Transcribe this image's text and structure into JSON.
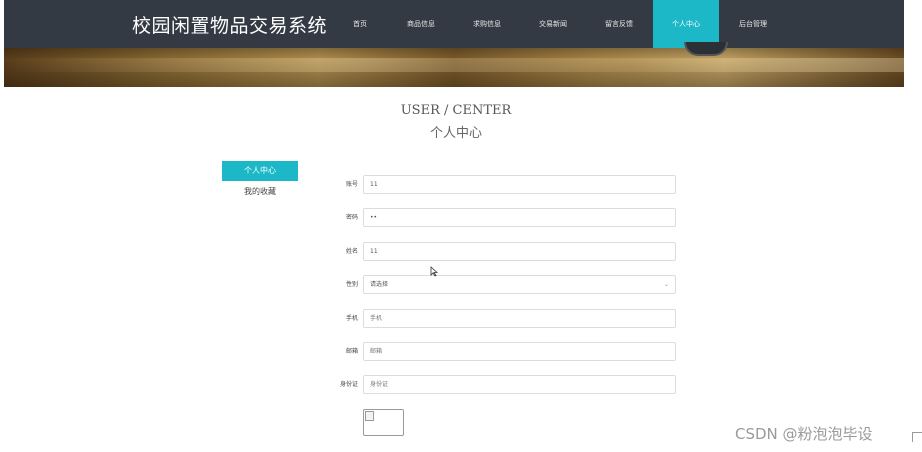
{
  "site": {
    "title": "校园闲置物品交易系统"
  },
  "nav": {
    "items": [
      {
        "label": "首页"
      },
      {
        "label": "商品信息"
      },
      {
        "label": "求购信息"
      },
      {
        "label": "交易新闻"
      },
      {
        "label": "留言反馈"
      },
      {
        "label": "个人中心"
      },
      {
        "label": "后台管理"
      }
    ],
    "active": "个人中心"
  },
  "heading": {
    "en": "USER / CENTER",
    "cn": "个人中心"
  },
  "side_menu": {
    "items": [
      {
        "label": "个人中心"
      },
      {
        "label": "我的收藏"
      }
    ]
  },
  "form": {
    "account": {
      "label": "账号",
      "value": "11"
    },
    "password": {
      "label": "密码",
      "value": "••"
    },
    "name": {
      "label": "姓名",
      "value": "11"
    },
    "gender": {
      "label": "性别",
      "value": "请选择"
    },
    "phone": {
      "label": "手机",
      "placeholder": "手机"
    },
    "email": {
      "label": "邮箱",
      "placeholder": "邮箱"
    },
    "id_card": {
      "label": "身份证",
      "placeholder": "身份证"
    }
  },
  "watermark": "CSDN @粉泡泡毕设",
  "colors": {
    "accent": "#1db8c8",
    "topbar": "#333a44"
  }
}
